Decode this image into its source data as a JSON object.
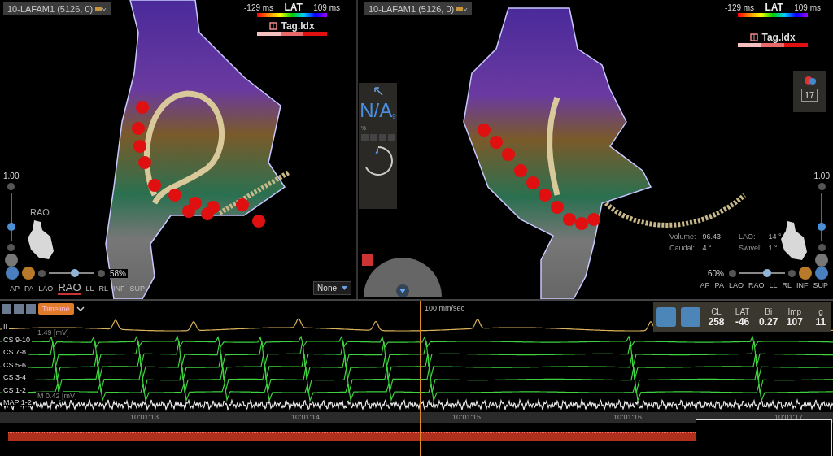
{
  "views": [
    {
      "title": "10-LAFAM1 (5126, 0)",
      "lat_legend": {
        "min": "-129 ms",
        "label": "LAT",
        "max": "109 ms"
      },
      "tag_legend": {
        "label": "Tag.Idx"
      },
      "zoom": {
        "value": "1.00",
        "level": 0.3
      },
      "orientation_label": "RAO",
      "scale": {
        "value": "58%",
        "level": 0.58
      },
      "view_buttons": [
        {
          "label": "AP",
          "selected": false
        },
        {
          "label": "PA",
          "selected": false
        },
        {
          "label": "LAO",
          "selected": false
        },
        {
          "label": "RAO",
          "selected": true
        },
        {
          "label": "LL",
          "selected": false
        },
        {
          "label": "RL",
          "selected": false
        },
        {
          "label": "INF",
          "selected": false
        },
        {
          "label": "SUP",
          "selected": false
        }
      ],
      "dropdown": {
        "value": "None"
      }
    },
    {
      "title": "10-LAFAM1 (5126, 0)",
      "lat_legend": {
        "min": "-129 ms",
        "label": "LAT",
        "max": "109 ms"
      },
      "tag_legend": {
        "label": "Tag.Idx"
      },
      "zoom": {
        "value": "1.00",
        "level": 0.3
      },
      "scale": {
        "value": "60%",
        "level": 0.6
      },
      "view_buttons": [
        {
          "label": "AP",
          "selected": false
        },
        {
          "label": "PA",
          "selected": false
        },
        {
          "label": "LAO",
          "selected": false
        },
        {
          "label": "RAO",
          "selected": false
        },
        {
          "label": "LL",
          "selected": false
        },
        {
          "label": "RL",
          "selected": false
        },
        {
          "label": "INF",
          "selected": false
        },
        {
          "label": "SUP",
          "selected": false
        }
      ],
      "tool_panel": {
        "value": "N/A",
        "unit": "g",
        "percent_label": "%"
      },
      "counter": "17",
      "info": [
        {
          "label": "Volume:",
          "value": "96.43"
        },
        {
          "label": "LAO:",
          "value": "14 °"
        },
        {
          "label": "Caudal:",
          "value": "4 °"
        },
        {
          "label": "Swivel:",
          "value": "1 °"
        }
      ]
    }
  ],
  "ecg": {
    "timeline_button": "Timeline",
    "speed": "100 mm/sec",
    "channels": [
      {
        "name": "II",
        "scale": "1.49 [mV]",
        "kind": "surface",
        "color": "#d9b25a"
      },
      {
        "name": "CS 9-10",
        "kind": "bipolar",
        "color": "#3fd23f"
      },
      {
        "name": "CS 7-8",
        "kind": "bipolar",
        "color": "#3fd23f"
      },
      {
        "name": "CS 5-6",
        "kind": "bipolar",
        "color": "#3fd23f"
      },
      {
        "name": "CS 3-4",
        "kind": "bipolar",
        "color": "#3fd23f"
      },
      {
        "name": "CS 1-2",
        "scale": "M 0.42 [mV]",
        "kind": "bipolar",
        "color": "#3fd23f"
      },
      {
        "name": "MAP 1-2",
        "kind": "map",
        "color": "#e8e8e8"
      }
    ],
    "readouts": [
      {
        "label": "CL",
        "value": "258"
      },
      {
        "label": "LAT",
        "value": "-46"
      },
      {
        "label": "Bi",
        "value": "0.27"
      },
      {
        "label": "Imp",
        "value": "107"
      },
      {
        "label": "g",
        "value": "11"
      }
    ],
    "time_ticks": [
      "10:01:13",
      "10:01:14",
      "10:01:15",
      "10:01:16",
      "10:01:17"
    ]
  }
}
